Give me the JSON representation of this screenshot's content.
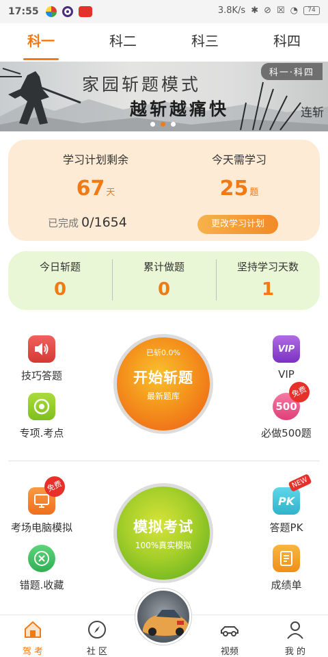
{
  "status_bar": {
    "time": "17:55",
    "speed": "3.8K/s",
    "battery": "74"
  },
  "tabs": [
    {
      "label": "科一",
      "active": true
    },
    {
      "label": "科二",
      "active": false
    },
    {
      "label": "科三",
      "active": false
    },
    {
      "label": "科四",
      "active": false
    }
  ],
  "banner": {
    "line1": "家园斩题模式",
    "line2": "越斩越痛快",
    "badge": "科一·科四",
    "stamp": "连斩",
    "dots": 3,
    "active_dot": 1
  },
  "plan": {
    "remaining_label": "学习计划剩余",
    "remaining_value": "67",
    "remaining_unit": "天",
    "today_label": "今天需学习",
    "today_value": "25",
    "today_unit": "题",
    "done_label": "已完成",
    "done_value": "0/1654",
    "change_button": "更改学习计划"
  },
  "stats": [
    {
      "label": "今日斩题",
      "value": "0"
    },
    {
      "label": "累计做题",
      "value": "0"
    },
    {
      "label": "坚持学习天数",
      "value": "1"
    }
  ],
  "features": {
    "tips": "技巧答题",
    "special": "专项.考点",
    "vip": "VIP",
    "must500": "必做500题",
    "exam_sim": "考场电脑模拟",
    "wrong": "错题.收藏",
    "pk": "答题PK",
    "report": "成绩单",
    "free_badge": "免费",
    "new_badge": "NEW",
    "vip_icon_text": "VIP",
    "must500_icon_text": "500",
    "pk_icon_text": "PK"
  },
  "start_circle": {
    "progress": "已斩0.0%",
    "title": "开始斩题",
    "subtitle": "最新题库"
  },
  "mock_circle": {
    "title": "模拟考试",
    "subtitle": "100%真实模拟"
  },
  "nav": [
    {
      "label": "驾 考",
      "active": true
    },
    {
      "label": "社 区",
      "active": false
    },
    {
      "label": "视频",
      "active": false
    },
    {
      "label": "我 的",
      "active": false
    }
  ],
  "colors": {
    "accent": "#f07a16",
    "plan_bg": "#fdebd5",
    "stats_bg": "#eaf7d6"
  }
}
